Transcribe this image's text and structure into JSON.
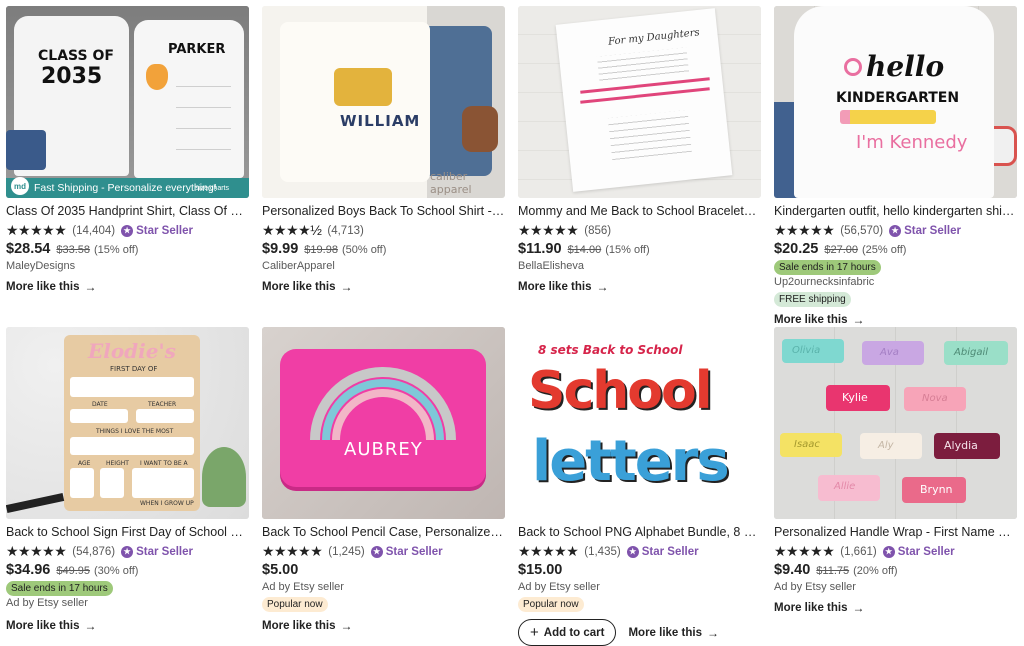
{
  "listings": [
    {
      "title": "Class Of 2035 Handprint Shirt, Class Of 2035 ...",
      "stars": "★★★★★",
      "count": "(14,404)",
      "star_seller": "Star Seller",
      "price": "$28.54",
      "original_price": "$33.58",
      "discount": "(15% off)",
      "seller": "MaleyDesigns",
      "more_label": "More like this",
      "image": {
        "line1": "CLASS OF",
        "line2": "2035",
        "name": "PARKER",
        "banner": "Fast Shipping - Personalize everything!",
        "banner_right": "size charts"
      }
    },
    {
      "title": "Personalized Boys Back To School Shirt - First ...",
      "stars": "★★★★½",
      "count": "(4,713)",
      "price": "$9.99",
      "original_price": "$19.98",
      "discount": "(50% off)",
      "seller": "CaliberApparel",
      "more_label": "More like this",
      "image": {
        "name": "WILLIAM",
        "watermark": "caliber apparel"
      }
    },
    {
      "title": "Mommy and Me Back to School Bracelets, First...",
      "stars": "★★★★★",
      "count": "(856)",
      "price": "$11.90",
      "original_price": "$14.00",
      "discount": "(15% off)",
      "seller": "BellaElisheva",
      "more_label": "More like this",
      "image": {
        "heading": "For my Daughters"
      }
    },
    {
      "title": "Kindergarten outfit, hello kindergarten shirt, fir...",
      "stars": "★★★★★",
      "count": "(56,570)",
      "star_seller": "Star Seller",
      "price": "$20.25",
      "original_price": "$27.00",
      "discount": "(25% off)",
      "sale_badge": "Sale ends in 17 hours",
      "seller": "Up2ournecksinfabric",
      "free_shipping": "FREE shipping",
      "more_label": "More like this",
      "image": {
        "line1": "hello",
        "line2": "KINDERGARTEN",
        "name": "I'm Kennedy"
      }
    },
    {
      "title": "Back to School Sign First Day of School Sign P...",
      "stars": "★★★★★",
      "count": "(54,876)",
      "star_seller": "Star Seller",
      "price": "$34.96",
      "original_price": "$49.95",
      "discount": "(30% off)",
      "sale_badge": "Sale ends in 17 hours",
      "seller": "Ad by Etsy seller",
      "more_label": "More like this",
      "image": {
        "name": "Elodie's",
        "sub": "FIRST DAY OF",
        "date": "DATE",
        "teacher": "TEACHER",
        "things": "THINGS I LOVE THE MOST",
        "age": "AGE",
        "height": "HEIGHT",
        "want": "I WANT TO BE A",
        "grow": "WHEN I GROW UP"
      }
    },
    {
      "title": "Back To School Pencil Case, Personalized Penc...",
      "stars": "★★★★★",
      "count": "(1,245)",
      "star_seller": "Star Seller",
      "price": "$5.00",
      "seller": "Ad by Etsy seller",
      "popular": "Popular now",
      "more_label": "More like this",
      "image": {
        "name": "AUBREY"
      }
    },
    {
      "title": "Back to School PNG Alphabet Bundle, 8 Sets, F...",
      "stars": "★★★★★",
      "count": "(1,435)",
      "star_seller": "Star Seller",
      "price": "$15.00",
      "seller": "Ad by Etsy seller",
      "popular": "Popular now",
      "cart_label": "Add to cart",
      "more_label": "More like this",
      "image": {
        "top": "8 sets Back to School",
        "line1": "School",
        "line2": "letters"
      }
    },
    {
      "title": "Personalized Handle Wrap - First Name or Mon...",
      "stars": "★★★★★",
      "count": "(1,661)",
      "star_seller": "Star Seller",
      "price": "$9.40",
      "original_price": "$11.75",
      "discount": "(20% off)",
      "seller": "Ad by Etsy seller",
      "more_label": "More like this",
      "image": {
        "n1": "Olivia",
        "n2": "Ava",
        "n3": "Abigail",
        "n4": "Kylie",
        "n5": "Nova",
        "n6": "Isaac",
        "n7": "Aly",
        "n8": "Alydia",
        "n9": "Allie",
        "n10": "Brynn"
      }
    }
  ],
  "colors": {
    "star_seller": "#7f53ac",
    "sale_badge": "#9ec97a",
    "popular_badge": "#fdebd2",
    "free_shipping": "#d4e9d7"
  }
}
